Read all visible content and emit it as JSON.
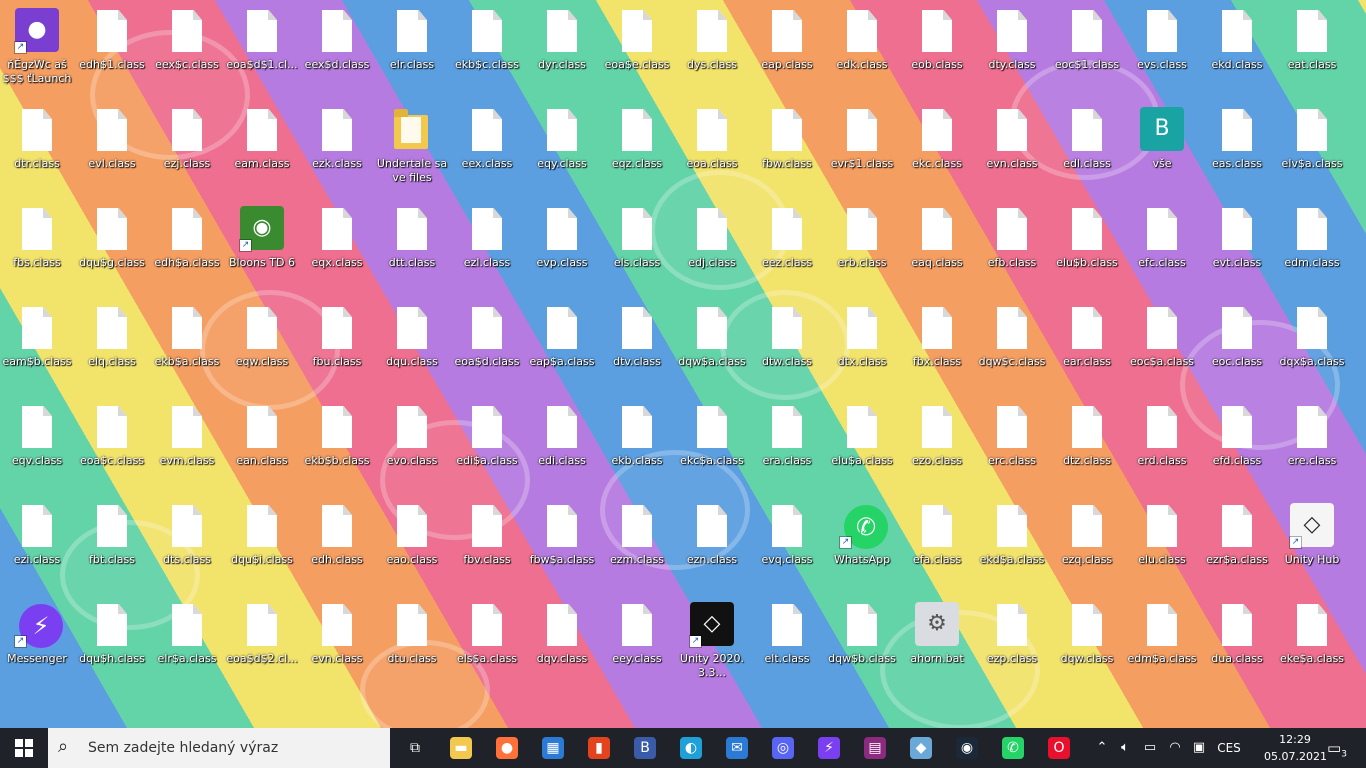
{
  "desktop": {
    "icons": [
      {
        "label": "ňĚgzWc aš$$$ ťLauncher",
        "kind": "app",
        "color": "#7a3fd1",
        "symbol": "●",
        "shortcut": true
      },
      {
        "label": "edh$1.class",
        "kind": "file"
      },
      {
        "label": "eex$c.class",
        "kind": "file"
      },
      {
        "label": "eoa$d$1.cl...",
        "kind": "file"
      },
      {
        "label": "eex$d.class",
        "kind": "file"
      },
      {
        "label": "elr.class",
        "kind": "file"
      },
      {
        "label": "ekb$c.class",
        "kind": "file"
      },
      {
        "label": "dyr.class",
        "kind": "file"
      },
      {
        "label": "eoa$e.class",
        "kind": "file"
      },
      {
        "label": "dys.class",
        "kind": "file"
      },
      {
        "label": "eap.class",
        "kind": "file"
      },
      {
        "label": "edk.class",
        "kind": "file"
      },
      {
        "label": "eob.class",
        "kind": "file"
      },
      {
        "label": "dty.class",
        "kind": "file"
      },
      {
        "label": "eoc$1.class",
        "kind": "file"
      },
      {
        "label": "evs.class",
        "kind": "file"
      },
      {
        "label": "ekd.class",
        "kind": "file"
      },
      {
        "label": "eat.class",
        "kind": "file"
      },
      {
        "label": "dtr.class",
        "kind": "file"
      },
      {
        "label": "evl.class",
        "kind": "file"
      },
      {
        "label": "ezj.class",
        "kind": "file"
      },
      {
        "label": "eam.class",
        "kind": "file"
      },
      {
        "label": "ezk.class",
        "kind": "file"
      },
      {
        "label": "Undertale save files",
        "kind": "folder"
      },
      {
        "label": "eex.class",
        "kind": "file"
      },
      {
        "label": "eqy.class",
        "kind": "file"
      },
      {
        "label": "eqz.class",
        "kind": "file"
      },
      {
        "label": "eoa.class",
        "kind": "file"
      },
      {
        "label": "fbw.class",
        "kind": "file"
      },
      {
        "label": "evr$1.class",
        "kind": "file"
      },
      {
        "label": "ekc.class",
        "kind": "file"
      },
      {
        "label": "evn.class",
        "kind": "file"
      },
      {
        "label": "edl.class",
        "kind": "file"
      },
      {
        "label": "vše",
        "kind": "app",
        "color": "#1aa3a3",
        "symbol": "B"
      },
      {
        "label": "eas.class",
        "kind": "file"
      },
      {
        "label": "elv$a.class",
        "kind": "file"
      },
      {
        "label": "fbs.class",
        "kind": "file"
      },
      {
        "label": "dqu$g.class",
        "kind": "file"
      },
      {
        "label": "edh$a.class",
        "kind": "file"
      },
      {
        "label": "Bloons TD 6",
        "kind": "app",
        "color": "#3a8a2f",
        "symbol": "◉",
        "shortcut": true
      },
      {
        "label": "eqx.class",
        "kind": "file"
      },
      {
        "label": "dtt.class",
        "kind": "file"
      },
      {
        "label": "ezl.class",
        "kind": "file"
      },
      {
        "label": "evp.class",
        "kind": "file"
      },
      {
        "label": "els.class",
        "kind": "file"
      },
      {
        "label": "edj.class",
        "kind": "file"
      },
      {
        "label": "eez.class",
        "kind": "file"
      },
      {
        "label": "erb.class",
        "kind": "file"
      },
      {
        "label": "eaq.class",
        "kind": "file"
      },
      {
        "label": "efb.class",
        "kind": "file"
      },
      {
        "label": "elu$b.class",
        "kind": "file"
      },
      {
        "label": "efc.class",
        "kind": "file"
      },
      {
        "label": "evt.class",
        "kind": "file"
      },
      {
        "label": "edm.class",
        "kind": "file"
      },
      {
        "label": "eam$b.class",
        "kind": "file"
      },
      {
        "label": "elq.class",
        "kind": "file"
      },
      {
        "label": "ekb$a.class",
        "kind": "file"
      },
      {
        "label": "eqw.class",
        "kind": "file"
      },
      {
        "label": "fbu.class",
        "kind": "file"
      },
      {
        "label": "dqu.class",
        "kind": "file"
      },
      {
        "label": "eoa$d.class",
        "kind": "file"
      },
      {
        "label": "eap$a.class",
        "kind": "file"
      },
      {
        "label": "dtv.class",
        "kind": "file"
      },
      {
        "label": "dqw$a.class",
        "kind": "file"
      },
      {
        "label": "dtw.class",
        "kind": "file"
      },
      {
        "label": "dtx.class",
        "kind": "file"
      },
      {
        "label": "fbx.class",
        "kind": "file"
      },
      {
        "label": "dqw$c.class",
        "kind": "file"
      },
      {
        "label": "ear.class",
        "kind": "file"
      },
      {
        "label": "eoc$a.class",
        "kind": "file"
      },
      {
        "label": "eoc.class",
        "kind": "file"
      },
      {
        "label": "dqx$a.class",
        "kind": "file"
      },
      {
        "label": "eqv.class",
        "kind": "file"
      },
      {
        "label": "eoa$c.class",
        "kind": "file"
      },
      {
        "label": "evm.class",
        "kind": "file"
      },
      {
        "label": "ean.class",
        "kind": "file"
      },
      {
        "label": "ekb$b.class",
        "kind": "file"
      },
      {
        "label": "evo.class",
        "kind": "file"
      },
      {
        "label": "edi$a.class",
        "kind": "file"
      },
      {
        "label": "edi.class",
        "kind": "file"
      },
      {
        "label": "ekb.class",
        "kind": "file"
      },
      {
        "label": "ekc$a.class",
        "kind": "file"
      },
      {
        "label": "era.class",
        "kind": "file"
      },
      {
        "label": "elu$a.class",
        "kind": "file"
      },
      {
        "label": "ezo.class",
        "kind": "file"
      },
      {
        "label": "erc.class",
        "kind": "file"
      },
      {
        "label": "dtz.class",
        "kind": "file"
      },
      {
        "label": "erd.class",
        "kind": "file"
      },
      {
        "label": "efd.class",
        "kind": "file"
      },
      {
        "label": "ere.class",
        "kind": "file"
      },
      {
        "label": "ezi.class",
        "kind": "file"
      },
      {
        "label": "fbt.class",
        "kind": "file"
      },
      {
        "label": "dts.class",
        "kind": "file"
      },
      {
        "label": "dqu$i.class",
        "kind": "file"
      },
      {
        "label": "edh.class",
        "kind": "file"
      },
      {
        "label": "eao.class",
        "kind": "file"
      },
      {
        "label": "fbv.class",
        "kind": "file"
      },
      {
        "label": "fbw$a.class",
        "kind": "file"
      },
      {
        "label": "ezm.class",
        "kind": "file"
      },
      {
        "label": "ezn.class",
        "kind": "file"
      },
      {
        "label": "evq.class",
        "kind": "file"
      },
      {
        "label": "WhatsApp",
        "kind": "circle",
        "color": "#25d366",
        "symbol": "✆",
        "shortcut": true
      },
      {
        "label": "efa.class",
        "kind": "file"
      },
      {
        "label": "ekd$a.class",
        "kind": "file"
      },
      {
        "label": "ezq.class",
        "kind": "file"
      },
      {
        "label": "elu.class",
        "kind": "file"
      },
      {
        "label": "ezr$a.class",
        "kind": "file"
      },
      {
        "label": "Unity Hub",
        "kind": "app",
        "color": "#f5f5f5",
        "symbol": "◇",
        "fg": "#222",
        "shortcut": true
      },
      {
        "label": "Messenger",
        "kind": "circle",
        "color": "#7b3ff2",
        "symbol": "⚡",
        "shortcut": true
      },
      {
        "label": "dqu$h.class",
        "kind": "file"
      },
      {
        "label": "elr$a.class",
        "kind": "file"
      },
      {
        "label": "eoa$d$2.cl...",
        "kind": "file"
      },
      {
        "label": "evn.class",
        "kind": "file"
      },
      {
        "label": "dtu.class",
        "kind": "file"
      },
      {
        "label": "els$a.class",
        "kind": "file"
      },
      {
        "label": "dqv.class",
        "kind": "file"
      },
      {
        "label": "eey.class",
        "kind": "file"
      },
      {
        "label": "Unity 2020.3.3...",
        "kind": "app",
        "color": "#111111",
        "symbol": "◇",
        "shortcut": true
      },
      {
        "label": "elt.class",
        "kind": "file"
      },
      {
        "label": "dqw$b.class",
        "kind": "file"
      },
      {
        "label": "ahorn.bat",
        "kind": "app",
        "color": "#d9dde2",
        "symbol": "⚙",
        "fg": "#555"
      },
      {
        "label": "ezp.class",
        "kind": "file"
      },
      {
        "label": "dqw.class",
        "kind": "file"
      },
      {
        "label": "edm$a.class",
        "kind": "file"
      },
      {
        "label": "dua.class",
        "kind": "file"
      },
      {
        "label": "eke$a.class",
        "kind": "file"
      }
    ]
  },
  "taskbar": {
    "search_placeholder": "Sem zadejte hledaný výraz",
    "apps": [
      {
        "name": "task-view",
        "symbol": "⧉",
        "color": "transparent"
      },
      {
        "name": "file-explorer",
        "symbol": "▬",
        "color": "#f3c94d"
      },
      {
        "name": "firefox",
        "symbol": "●",
        "color": "#ff7139"
      },
      {
        "name": "microsoft-store",
        "symbol": "▦",
        "color": "#2b7bd6"
      },
      {
        "name": "office",
        "symbol": "▮",
        "color": "#e3431d"
      },
      {
        "name": "bloons",
        "symbol": "B",
        "color": "#3a5ca8"
      },
      {
        "name": "edge",
        "symbol": "◐",
        "color": "#1fa0d8"
      },
      {
        "name": "mail",
        "symbol": "✉",
        "color": "#2b7bd6"
      },
      {
        "name": "discord",
        "symbol": "◎",
        "color": "#5865f2"
      },
      {
        "name": "messenger",
        "symbol": "⚡",
        "color": "#7b3ff2"
      },
      {
        "name": "winrar",
        "symbol": "▤",
        "color": "#8b2a7e"
      },
      {
        "name": "notepad-tool",
        "symbol": "◆",
        "color": "#6aa8d8"
      },
      {
        "name": "steam",
        "symbol": "◉",
        "color": "#1b2838"
      },
      {
        "name": "whatsapp",
        "symbol": "✆",
        "color": "#25d366"
      },
      {
        "name": "opera",
        "symbol": "O",
        "color": "#e8102d"
      }
    ],
    "tray": {
      "language": "CES",
      "time": "12:29",
      "date": "05.07.2021",
      "notifications": "3"
    }
  }
}
